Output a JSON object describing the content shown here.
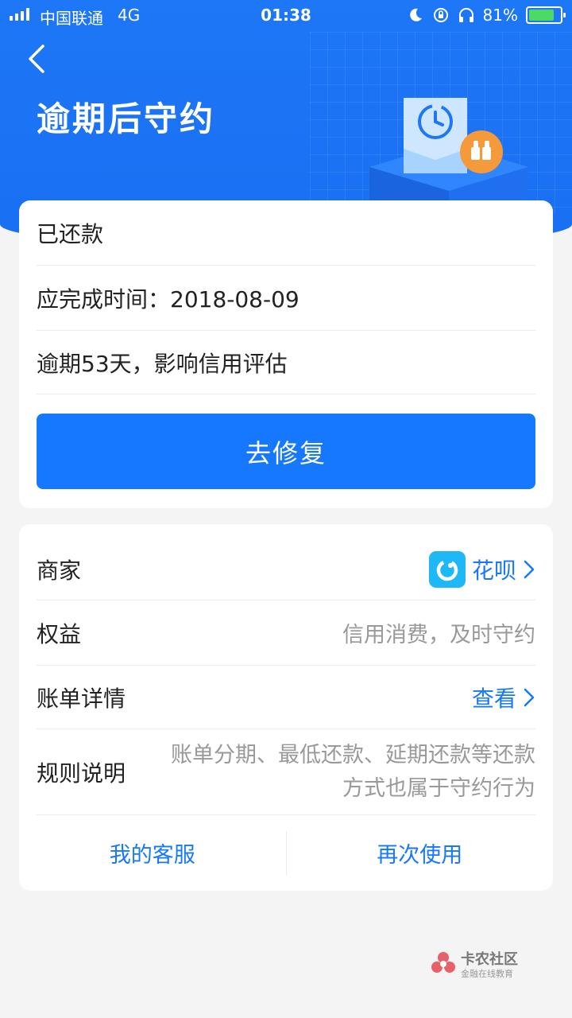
{
  "status_bar": {
    "carrier": "中国联通",
    "network": "4G",
    "time": "01:38",
    "battery_percent": "81%",
    "battery_level": 0.81
  },
  "header": {
    "title": "逾期后守约"
  },
  "status_card": {
    "status": "已还款",
    "due_label": "应完成时间：2018-08-09",
    "overdue_text": "逾期53天，影响信用评估",
    "fix_button": "去修复"
  },
  "detail_card": {
    "merchant_label": "商家",
    "merchant_value": "花呗",
    "benefit_label": "权益",
    "benefit_value": "信用消费，及时守约",
    "bill_label": "账单详情",
    "bill_action": "查看",
    "rule_label": "规则说明",
    "rule_line1": "账单分期、最低还款、延期还款等还款",
    "rule_line2": "方式也属于守约行为",
    "customer_service": "我的客服",
    "use_again": "再次使用"
  },
  "watermark": {
    "title": "卡农社区",
    "subtitle": "金融在线教育"
  },
  "colors": {
    "header_blue": "#1a6ff2",
    "primary": "#1677ff",
    "huabei": "#1db8f5",
    "badge_orange": "#f59a3a"
  }
}
